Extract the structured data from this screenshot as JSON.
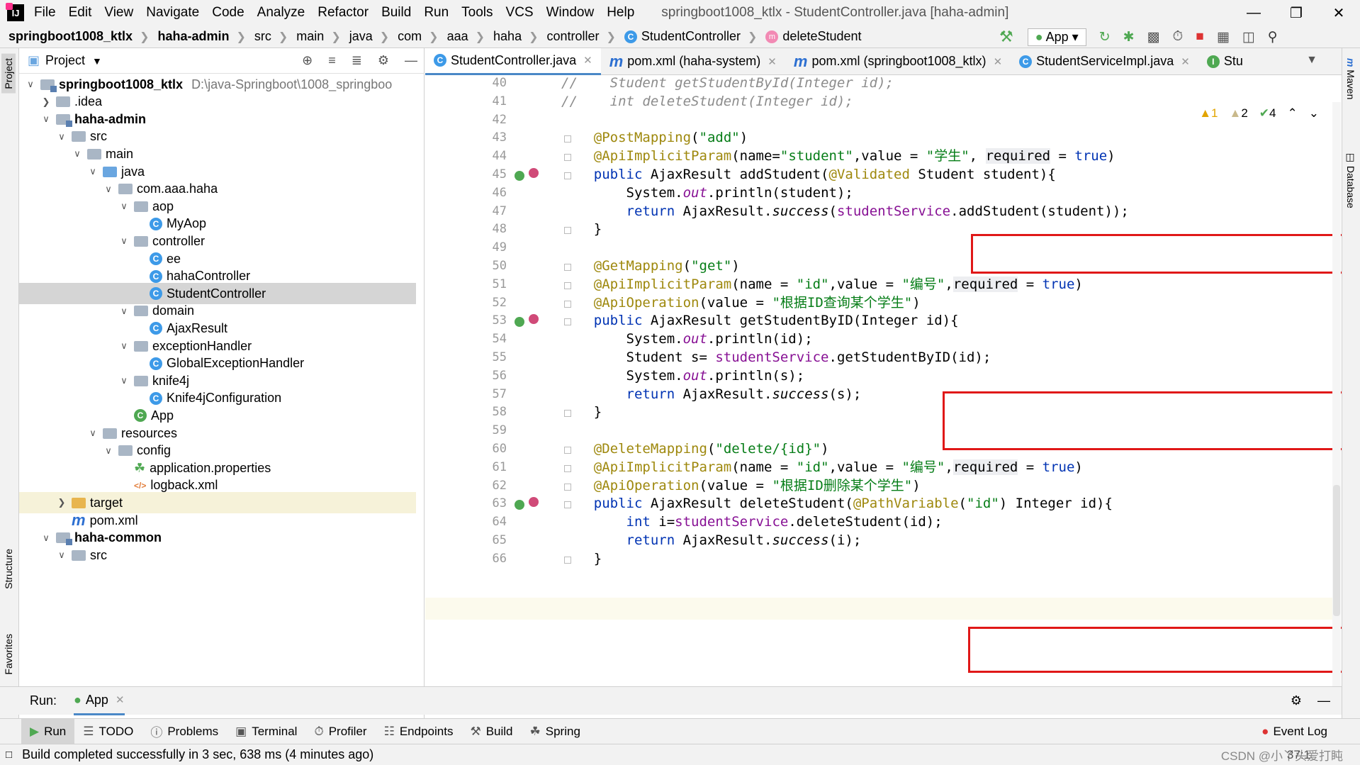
{
  "app": {
    "menu": [
      "File",
      "Edit",
      "View",
      "Navigate",
      "Code",
      "Analyze",
      "Refactor",
      "Build",
      "Run",
      "Tools",
      "VCS",
      "Window",
      "Help"
    ],
    "window_title": "springboot1008_ktlx - StudentController.java [haha-admin]"
  },
  "breadcrumb": [
    "springboot1008_ktlx",
    "haha-admin",
    "src",
    "main",
    "java",
    "com",
    "aaa",
    "haha",
    "controller",
    "StudentController",
    "deleteStudent"
  ],
  "run_config": "App",
  "project": {
    "title": "Project",
    "tree": [
      {
        "label": "springboot1008_ktlx",
        "path": "D:\\java-Springboot\\1008_springboo",
        "indent": 0,
        "arrow": "v",
        "icon": "folder-mod",
        "bold": true
      },
      {
        "label": ".idea",
        "indent": 1,
        "arrow": ">",
        "icon": "folder"
      },
      {
        "label": "haha-admin",
        "indent": 1,
        "arrow": "v",
        "icon": "folder-mod",
        "bold": true
      },
      {
        "label": "src",
        "indent": 2,
        "arrow": "v",
        "icon": "folder"
      },
      {
        "label": "main",
        "indent": 3,
        "arrow": "v",
        "icon": "folder"
      },
      {
        "label": "java",
        "indent": 4,
        "arrow": "v",
        "icon": "folder-blue"
      },
      {
        "label": "com.aaa.haha",
        "indent": 5,
        "arrow": "v",
        "icon": "folder"
      },
      {
        "label": "aop",
        "indent": 6,
        "arrow": "v",
        "icon": "folder"
      },
      {
        "label": "MyAop",
        "indent": 7,
        "arrow": "",
        "icon": "class"
      },
      {
        "label": "controller",
        "indent": 6,
        "arrow": "v",
        "icon": "folder"
      },
      {
        "label": "ee",
        "indent": 7,
        "arrow": "",
        "icon": "class"
      },
      {
        "label": "hahaController",
        "indent": 7,
        "arrow": "",
        "icon": "class"
      },
      {
        "label": "StudentController",
        "indent": 7,
        "arrow": "",
        "icon": "class",
        "selected": true
      },
      {
        "label": "domain",
        "indent": 6,
        "arrow": "v",
        "icon": "folder"
      },
      {
        "label": "AjaxResult",
        "indent": 7,
        "arrow": "",
        "icon": "class"
      },
      {
        "label": "exceptionHandler",
        "indent": 6,
        "arrow": "v",
        "icon": "folder"
      },
      {
        "label": "GlobalExceptionHandler",
        "indent": 7,
        "arrow": "",
        "icon": "class"
      },
      {
        "label": "knife4j",
        "indent": 6,
        "arrow": "v",
        "icon": "folder"
      },
      {
        "label": "Knife4jConfiguration",
        "indent": 7,
        "arrow": "",
        "icon": "class"
      },
      {
        "label": "App",
        "indent": 6,
        "arrow": "",
        "icon": "app"
      },
      {
        "label": "resources",
        "indent": 4,
        "arrow": "v",
        "icon": "folder"
      },
      {
        "label": "config",
        "indent": 5,
        "arrow": "v",
        "icon": "folder"
      },
      {
        "label": "application.properties",
        "indent": 6,
        "arrow": "",
        "icon": "props"
      },
      {
        "label": "logback.xml",
        "indent": 6,
        "arrow": "",
        "icon": "xml"
      },
      {
        "label": "target",
        "indent": 2,
        "arrow": ">",
        "icon": "folder-yel",
        "highlight": true
      },
      {
        "label": "pom.xml",
        "indent": 2,
        "arrow": "",
        "icon": "maven"
      },
      {
        "label": "haha-common",
        "indent": 1,
        "arrow": "v",
        "icon": "folder-mod",
        "bold": true
      },
      {
        "label": "src",
        "indent": 2,
        "arrow": "v",
        "icon": "folder"
      }
    ]
  },
  "tabs": [
    {
      "label": "StudentController.java",
      "icon": "class",
      "active": true
    },
    {
      "label": "pom.xml (haha-system)",
      "icon": "maven"
    },
    {
      "label": "pom.xml (springboot1008_ktlx)",
      "icon": "maven"
    },
    {
      "label": "StudentServiceImpl.java",
      "icon": "class"
    },
    {
      "label": "Stu",
      "icon": "interface"
    }
  ],
  "inspections": {
    "warn1": "1",
    "warn2": "2",
    "ok": "4"
  },
  "code_lines": [
    {
      "n": "40",
      "html": "<span class='cmt'>//    Student getStudentById(Integer id);</span>"
    },
    {
      "n": "41",
      "html": "<span class='cmt'>//    int deleteStudent(Integer id);</span>"
    },
    {
      "n": "42",
      "html": ""
    },
    {
      "n": "43",
      "html": "    <span class='ann'>@PostMapping</span>(<span class='str'>\"add\"</span>)"
    },
    {
      "n": "44",
      "html": "    <span class='ann'>@ApiImplicitParam</span>(name=<span class='str'>\"student\"</span>,value = <span class='str'>\"学生\"</span>, <span class='par'>required</span> = <span class='kw'>true</span>)"
    },
    {
      "n": "45",
      "html": "    <span class='kw'>public</span> AjaxResult addStudent(<span class='ann'>@Validated</span> Student student){"
    },
    {
      "n": "46",
      "html": "        System.<span class='fld it'>out</span>.println(student);"
    },
    {
      "n": "47",
      "html": "        <span class='kw'>return</span> AjaxResult.<span class='it'>success</span>(<span class='fld'>studentService</span>.addStudent(student));"
    },
    {
      "n": "48",
      "html": "    }"
    },
    {
      "n": "49",
      "html": ""
    },
    {
      "n": "50",
      "html": "    <span class='ann'>@GetMapping</span>(<span class='str'>\"get\"</span>)"
    },
    {
      "n": "51",
      "html": "    <span class='ann'>@ApiImplicitParam</span>(name = <span class='str'>\"id\"</span>,value = <span class='str'>\"编号\"</span>,<span class='par'>required</span> = <span class='kw'>true</span>)"
    },
    {
      "n": "52",
      "html": "    <span class='ann'>@ApiOperation</span>(value = <span class='str'>\"根据ID查询某个学生\"</span>)"
    },
    {
      "n": "53",
      "html": "    <span class='kw'>public</span> AjaxResult getStudentByID(Integer id){"
    },
    {
      "n": "54",
      "html": "        System.<span class='fld it'>out</span>.println(id);"
    },
    {
      "n": "55",
      "html": "        Student s= <span class='fld'>studentService</span>.getStudentByID(id);"
    },
    {
      "n": "56",
      "html": "        System.<span class='fld it'>out</span>.println(s);"
    },
    {
      "n": "57",
      "html": "        <span class='kw'>return</span> AjaxResult.<span class='it'>success</span>(s);"
    },
    {
      "n": "58",
      "html": "    }"
    },
    {
      "n": "59",
      "html": ""
    },
    {
      "n": "60",
      "html": "    <span class='ann'>@DeleteMapping</span>(<span class='str'>\"delete/{id}\"</span>)"
    },
    {
      "n": "61",
      "html": "    <span class='ann'>@ApiImplicitParam</span>(name = <span class='str'>\"id\"</span>,value = <span class='str'>\"编号\"</span>,<span class='par'>required</span> = <span class='kw'>true</span>)"
    },
    {
      "n": "62",
      "html": "    <span class='ann'>@ApiOperation</span>(value = <span class='str'>\"根据ID删除某个学生\"</span>)"
    },
    {
      "n": "63",
      "html": "    <span class='kw'>public</span> AjaxResult deleteStudent(<span class='ann'>@PathVariable</span>(<span class='str'>\"id\"</span>) Integer id){"
    },
    {
      "n": "64",
      "html": "        <span class='kw'>int</span> i=<span class='fld'>studentService</span>.deleteStudent(id);"
    },
    {
      "n": "65",
      "html": "        <span class='kw'>return</span> AjaxResult.<span class='it'>success</span>(i);"
    },
    {
      "n": "66",
      "html": "    }"
    }
  ],
  "run": {
    "label": "Run:",
    "config": "App"
  },
  "toolwindows": [
    "Run",
    "TODO",
    "Problems",
    "Terminal",
    "Profiler",
    "Endpoints",
    "Build",
    "Spring"
  ],
  "event_log": "Event Log",
  "status_msg": "Build completed successfully in 3 sec, 638 ms (4 minutes ago)",
  "cursor_pos": "37:1",
  "watermark": "CSDN @小丫头爱打盹",
  "sidebar_tabs": {
    "left": [
      "Project",
      "Structure",
      "Favorites"
    ],
    "right": [
      "Maven",
      "Database"
    ]
  }
}
